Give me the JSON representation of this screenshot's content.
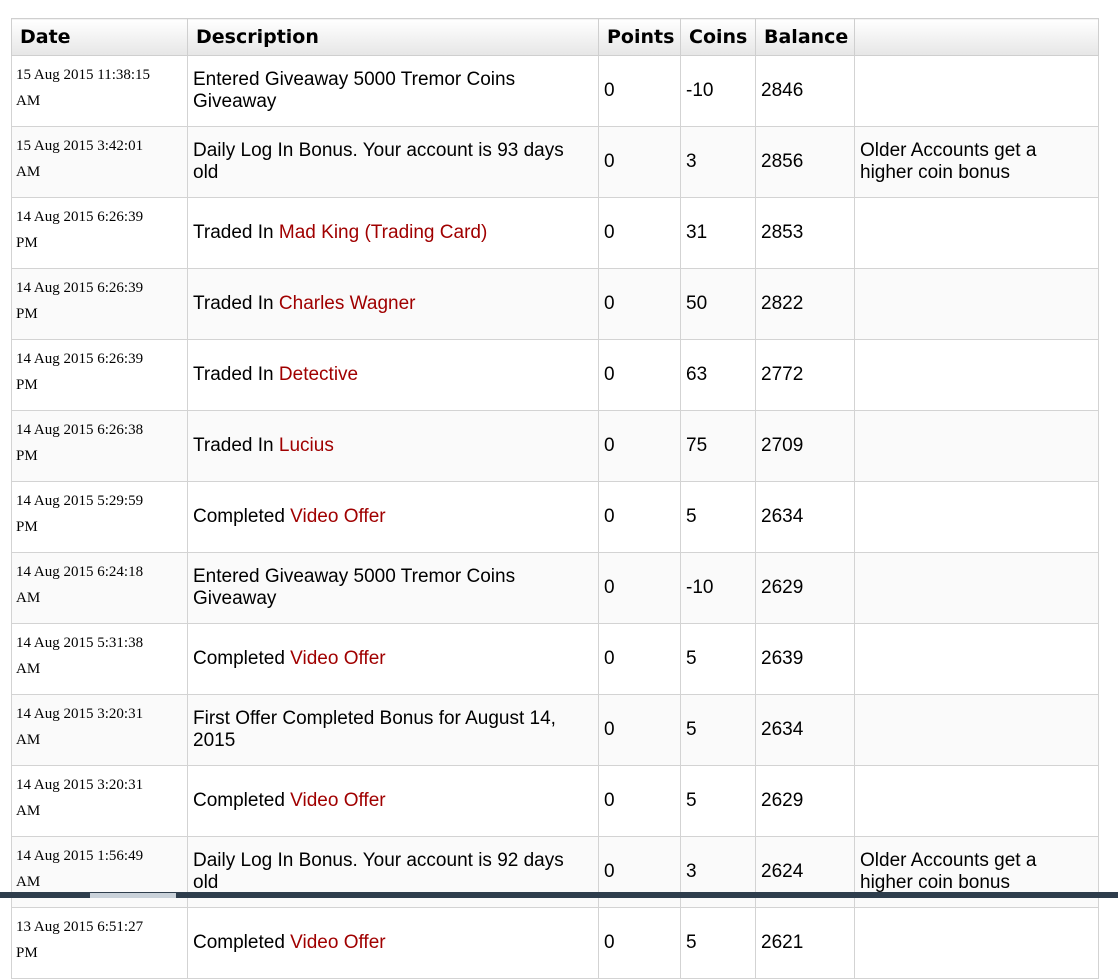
{
  "table": {
    "headers": {
      "date": "Date",
      "description": "Description",
      "points": "Points",
      "coins": "Coins",
      "balance": "Balance",
      "notes": ""
    },
    "rows": [
      {
        "date_line1": "15 Aug 2015 11:38:15",
        "date_line2": "AM",
        "desc_text": "Entered Giveaway 5000 Tremor Coins Giveaway",
        "desc_link": "",
        "points": "0",
        "coins": "-10",
        "balance": "2846",
        "note": ""
      },
      {
        "date_line1": "15 Aug 2015 3:42:01",
        "date_line2": "AM",
        "desc_text": "Daily Log In Bonus. Your account is 93 days old",
        "desc_link": "",
        "points": "0",
        "coins": "3",
        "balance": "2856",
        "note": "Older Accounts get a higher coin bonus"
      },
      {
        "date_line1": "14 Aug 2015 6:26:39",
        "date_line2": "PM",
        "desc_text": "Traded In ",
        "desc_link": "Mad King (Trading Card)",
        "points": "0",
        "coins": "31",
        "balance": "2853",
        "note": ""
      },
      {
        "date_line1": "14 Aug 2015 6:26:39",
        "date_line2": "PM",
        "desc_text": "Traded In ",
        "desc_link": "Charles Wagner",
        "points": "0",
        "coins": "50",
        "balance": "2822",
        "note": ""
      },
      {
        "date_line1": "14 Aug 2015 6:26:39",
        "date_line2": "PM",
        "desc_text": "Traded In ",
        "desc_link": "Detective",
        "points": "0",
        "coins": "63",
        "balance": "2772",
        "note": ""
      },
      {
        "date_line1": "14 Aug 2015 6:26:38",
        "date_line2": "PM",
        "desc_text": "Traded In ",
        "desc_link": "Lucius",
        "points": "0",
        "coins": "75",
        "balance": "2709",
        "note": ""
      },
      {
        "date_line1": "14 Aug 2015 5:29:59",
        "date_line2": "PM",
        "desc_text": "Completed ",
        "desc_link": "Video Offer",
        "points": "0",
        "coins": "5",
        "balance": "2634",
        "note": ""
      },
      {
        "date_line1": "14 Aug 2015 6:24:18",
        "date_line2": "AM",
        "desc_text": "Entered Giveaway 5000 Tremor Coins Giveaway",
        "desc_link": "",
        "points": "0",
        "coins": "-10",
        "balance": "2629",
        "note": ""
      },
      {
        "date_line1": "14 Aug 2015 5:31:38",
        "date_line2": "AM",
        "desc_text": "Completed ",
        "desc_link": "Video Offer",
        "points": "0",
        "coins": "5",
        "balance": "2639",
        "note": ""
      },
      {
        "date_line1": "14 Aug 2015 3:20:31",
        "date_line2": "AM",
        "desc_text": "First Offer Completed Bonus for August 14, 2015",
        "desc_link": "",
        "points": "0",
        "coins": "5",
        "balance": "2634",
        "note": ""
      },
      {
        "date_line1": "14 Aug 2015 3:20:31",
        "date_line2": "AM",
        "desc_text": "Completed ",
        "desc_link": "Video Offer",
        "points": "0",
        "coins": "5",
        "balance": "2629",
        "note": ""
      },
      {
        "date_line1": "14 Aug 2015 1:56:49",
        "date_line2": "AM",
        "desc_text": "Daily Log In Bonus. Your account is 92 days old",
        "desc_link": "",
        "points": "0",
        "coins": "3",
        "balance": "2624",
        "note": "Older Accounts get a higher coin bonus"
      },
      {
        "date_line1": "13 Aug 2015 6:51:27",
        "date_line2": "PM",
        "desc_text": "Completed ",
        "desc_link": "Video Offer",
        "points": "0",
        "coins": "5",
        "balance": "2621",
        "note": ""
      }
    ]
  },
  "colors": {
    "link": "#a00000",
    "header_bg": "#e6e6e6",
    "border": "#d3d3d3",
    "taskbar": "#2e3d4c"
  }
}
